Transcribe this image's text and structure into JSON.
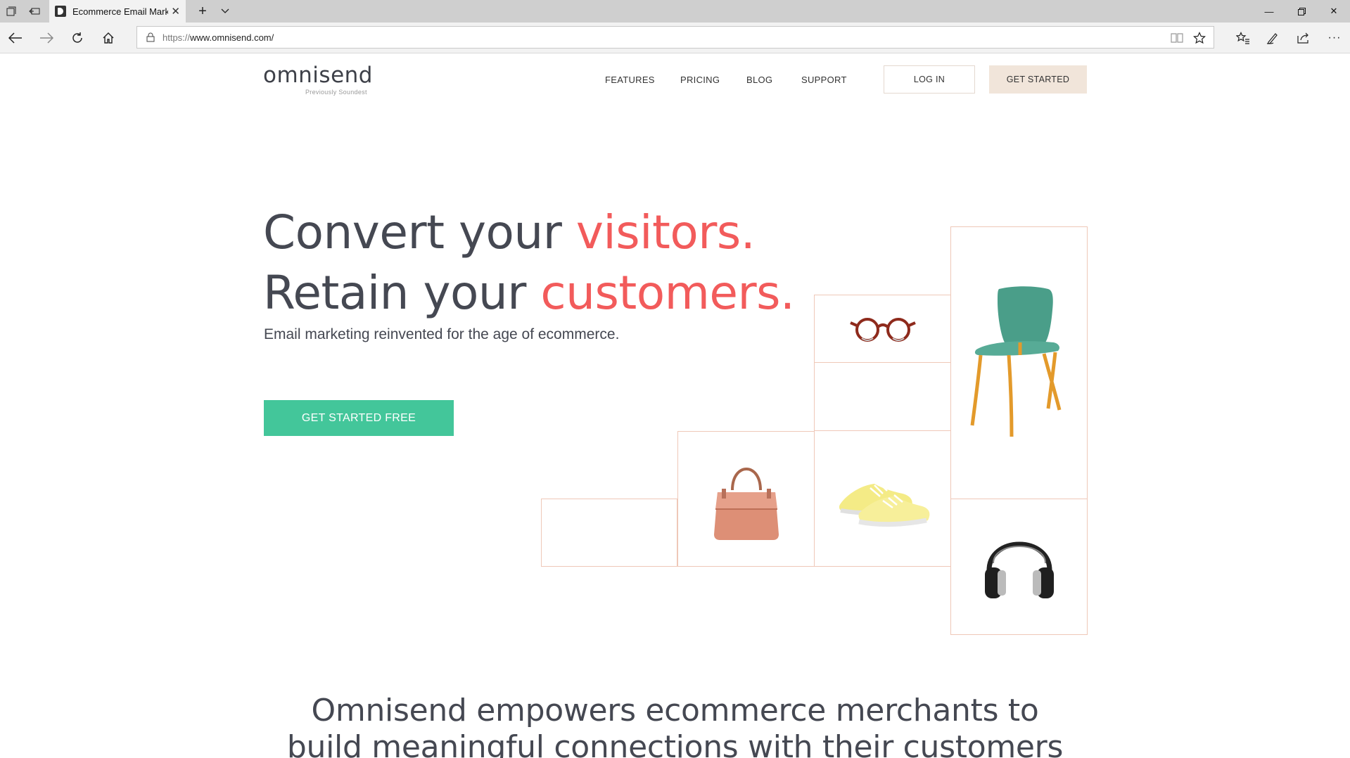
{
  "browser": {
    "tab_title": "Ecommerce Email Marke",
    "url_scheme": "https://",
    "url_host": "www.omnisend.com/"
  },
  "header": {
    "logo_text": "omnisend",
    "logo_tagline": "Previously Soundest",
    "menu": [
      "FEATURES",
      "PRICING",
      "BLOG",
      "SUPPORT"
    ],
    "login_label": "LOG IN",
    "get_started_label": "GET STARTED"
  },
  "hero": {
    "line1_prefix": "Convert your ",
    "line1_highlight": "visitors.",
    "line2_prefix": "Retain your ",
    "line2_highlight": "customers.",
    "subtitle": "Email marketing reinvented for the age of ecommerce.",
    "cta_label": "GET STARTED FREE"
  },
  "products": [
    "glasses-icon",
    "chair-icon",
    "handbag-icon",
    "sneakers-icon",
    "headphones-icon"
  ],
  "bottom": {
    "line1": "Omnisend empowers ecommerce merchants to",
    "line2": "build meaningful connections with their customers"
  },
  "colors": {
    "accent_red": "#f25b5b",
    "cta_green": "#43c69a",
    "button_beige": "#f1e5da",
    "grid_border": "#efc8b8"
  }
}
